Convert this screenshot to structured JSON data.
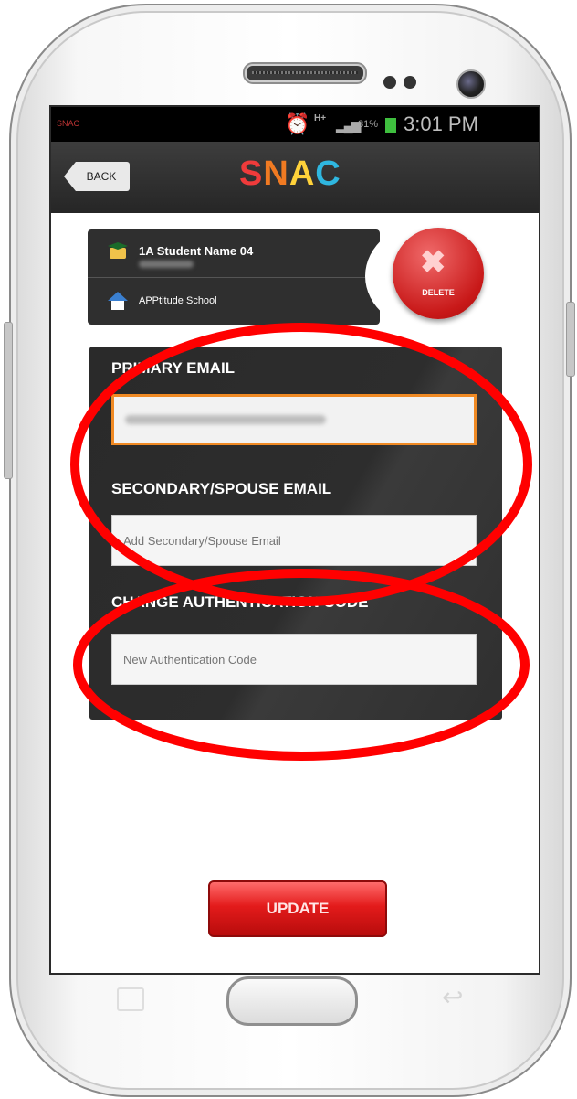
{
  "status_bar": {
    "app_name": "SNAC",
    "data_indicator": "H+",
    "battery_percent": "81%",
    "time": "3:01 PM"
  },
  "header": {
    "back_label": "BACK",
    "title_parts": [
      "S",
      "N",
      "A",
      "C"
    ]
  },
  "student": {
    "name": "1A Student Name 04",
    "school": "APPtitude School"
  },
  "delete_button": {
    "label": "DELETE"
  },
  "form": {
    "primary_email": {
      "label": "PRIMARY EMAIL",
      "value": ""
    },
    "secondary_email": {
      "label": "SECONDARY/SPOUSE EMAIL",
      "placeholder": "Add Secondary/Spouse Email"
    },
    "auth_code": {
      "label": "CHANGE AUTHENTICATION CODE",
      "placeholder": "New Authentication Code"
    }
  },
  "update_button": {
    "label": "UPDATE"
  },
  "colors": {
    "accent_red": "#e31b1b",
    "focus_orange": "#f08a24",
    "annotation_red": "#ff0000"
  }
}
